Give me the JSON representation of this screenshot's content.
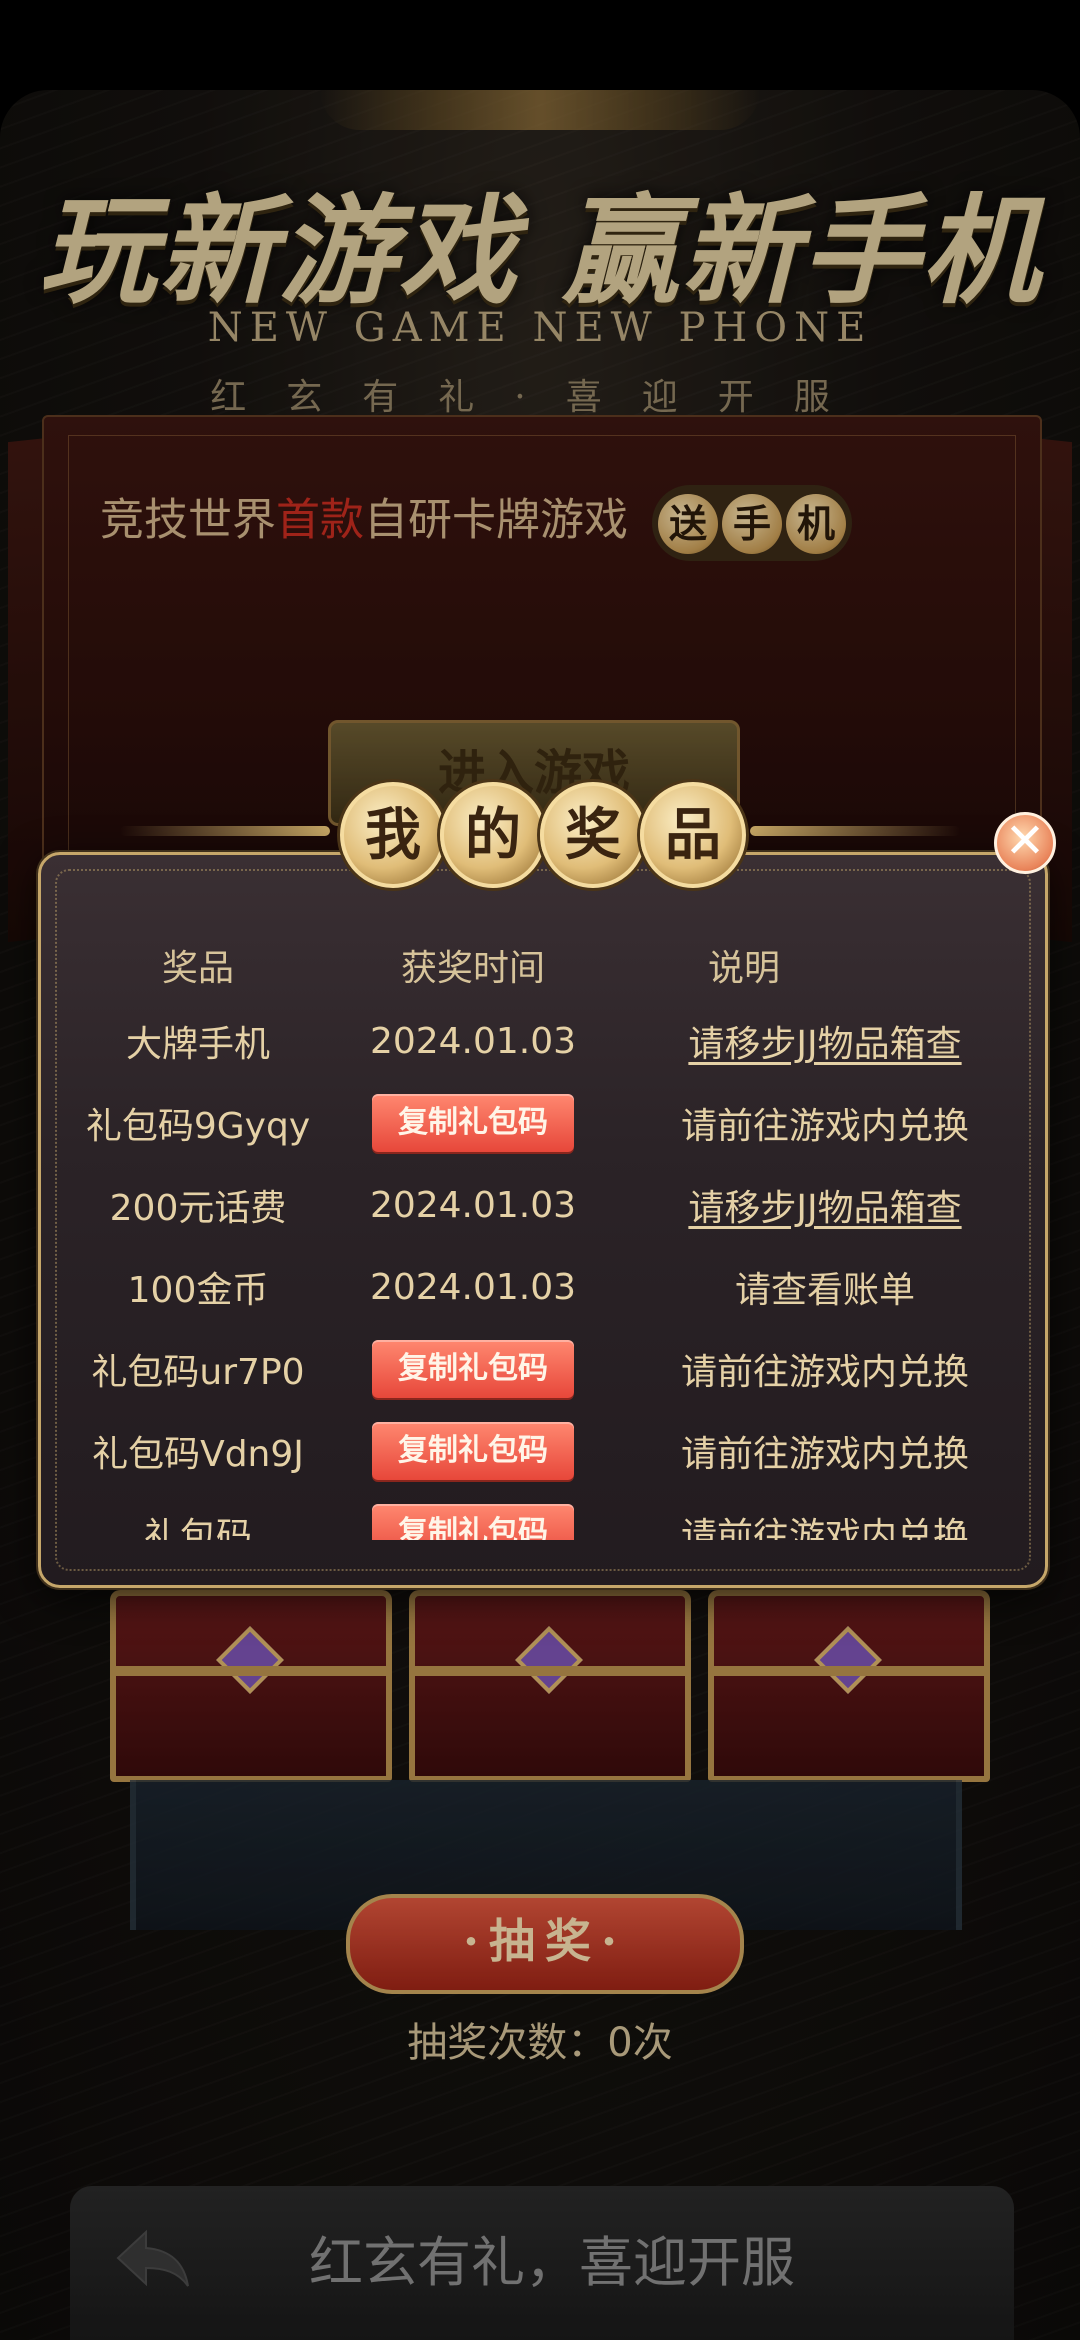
{
  "hero": {
    "title": "玩新游戏 赢新手机",
    "subtitle": "NEW GAME NEW PHONE",
    "tagline": "红玄有礼·喜迎开服"
  },
  "promo": {
    "text_before": "竞技世界",
    "text_highlight": "首款",
    "text_after": "自研卡牌游戏",
    "seal_chars": [
      "送",
      "手",
      "机"
    ],
    "enter_button": "进入游戏"
  },
  "modal": {
    "title_chars": [
      "我",
      "的",
      "奖",
      "品"
    ],
    "close_symbol": "✕",
    "columns": [
      "奖品",
      "获奖时间",
      "说明"
    ],
    "rows": [
      {
        "prize": "大牌手机",
        "time": "2024.01.03",
        "note": "请移步JJ物品箱查",
        "time_is_button": false,
        "note_is_link": true
      },
      {
        "prize": "礼包码9Gyqy",
        "time": "复制礼包码",
        "note": "请前往游戏内兑换",
        "time_is_button": true,
        "note_is_link": false
      },
      {
        "prize": "200元话费",
        "time": "2024.01.03",
        "note": "请移步JJ物品箱查",
        "time_is_button": false,
        "note_is_link": true
      },
      {
        "prize": "100金币",
        "time": "2024.01.03",
        "note": "请查看账单",
        "time_is_button": false,
        "note_is_link": false
      },
      {
        "prize": "礼包码ur7P0",
        "time": "复制礼包码",
        "note": "请前往游戏内兑换",
        "time_is_button": true,
        "note_is_link": false
      },
      {
        "prize": "礼包码Vdn9J",
        "time": "复制礼包码",
        "note": "请前往游戏内兑换",
        "time_is_button": true,
        "note_is_link": false
      },
      {
        "prize": "礼包码",
        "time": "复制礼包码",
        "note": "请前往游戏内兑换",
        "time_is_button": true,
        "note_is_link": false
      }
    ]
  },
  "draw": {
    "button": "·抽奖·",
    "count_text": "抽奖次数：0次"
  },
  "bottom_bar": {
    "title": "红玄有礼，喜迎开服",
    "back_icon": "back-arrow-icon"
  },
  "colors": {
    "accent_gold": "#c6a76a",
    "copy_button": "#e7473a",
    "highlight_red": "#c22b1f"
  }
}
